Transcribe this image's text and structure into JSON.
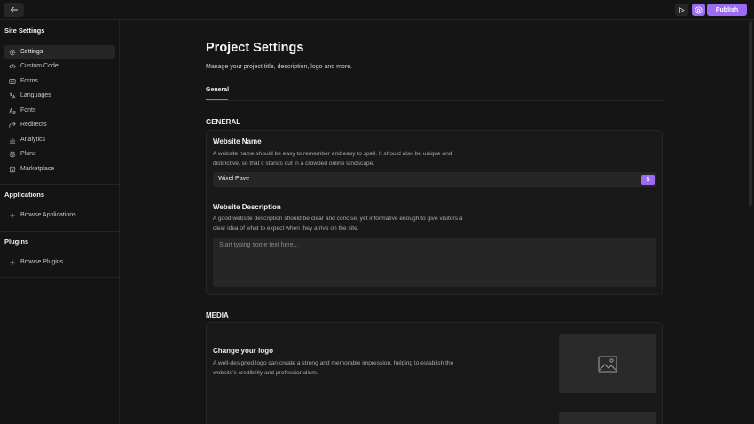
{
  "topbar": {
    "back_icon": "arrow-left-icon",
    "preview_icon": "play-icon",
    "ai_icon": "at-sign-icon",
    "publish_label": "Publish",
    "accent_color": "#9b6bf2"
  },
  "sidebar": {
    "site_settings_title": "Site Settings",
    "items": [
      {
        "label": "Settings",
        "icon": "gear-icon",
        "active": true
      },
      {
        "label": "Custom Code",
        "icon": "code-icon"
      },
      {
        "label": "Forms",
        "icon": "form-icon"
      },
      {
        "label": "Languages",
        "icon": "translate-icon"
      },
      {
        "label": "Fonts",
        "icon": "font-icon"
      },
      {
        "label": "Redirects",
        "icon": "redirect-icon"
      },
      {
        "label": "Analytics",
        "icon": "bar-chart-icon"
      },
      {
        "label": "Plans",
        "icon": "stack-icon"
      },
      {
        "label": "Marketplace",
        "icon": "store-icon"
      }
    ],
    "applications_title": "Applications",
    "browse_applications": "Browse Applications",
    "plugins_title": "Plugins",
    "browse_plugins": "Browse Plugins"
  },
  "main": {
    "title": "Project Settings",
    "subtitle": "Manage your project title, description, logo and more.",
    "tabs": [
      {
        "label": "General",
        "active": true
      }
    ],
    "general_heading": "GENERAL",
    "website_name": {
      "title": "Website Name",
      "description": "A website name should be easy to remember and easy to spell. It should also be unique and distinctive, so that it stands out in a crowded online landscape.",
      "value": "Wixel Pave",
      "badge": "S"
    },
    "website_description": {
      "title": "Website Description",
      "description": "A good website description should be clear and concise, yet informative enough to give visitors a clear idea of what to expect when they arrive on the site.",
      "placeholder": "Start typing some text here..."
    },
    "media_heading": "MEDIA",
    "logo": {
      "title": "Change your logo",
      "description": "A well-designed logo can create a strong and memorable impression, helping to establish the website's credibility and professionalism.",
      "icon": "image-icon"
    }
  }
}
